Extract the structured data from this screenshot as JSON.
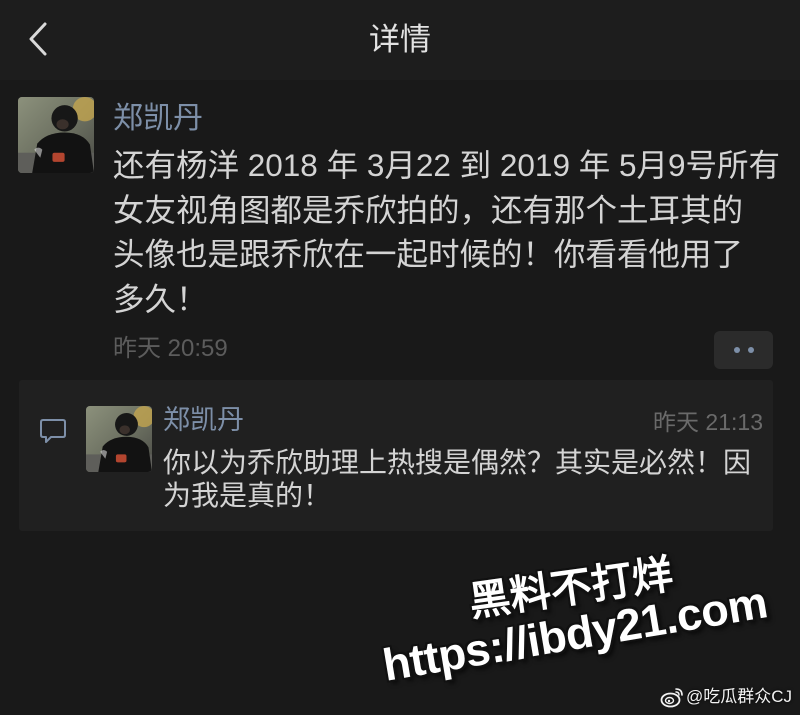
{
  "colors": {
    "background": "#191919",
    "topbar": "#1d1d1d",
    "panel": "#202020",
    "accent": "#7d8fa8",
    "text": "#d4d4d4",
    "muted": "#5c5c5c",
    "muted2": "#6a6a6a",
    "title": "#e3e3e3",
    "button": "#2b2b2b"
  },
  "icons": {
    "back": "chevron-left-icon",
    "more": "more-dots-icon",
    "comment": "comment-bubble-icon",
    "weibo": "weibo-logo-icon"
  },
  "header": {
    "title": "详情"
  },
  "post": {
    "author": "郑凯丹",
    "text_lines": [
      "还有杨洋 2018 年 3月22 到 2019 年 5月9号所有",
      "女友视角图都是乔欣拍的，还有那个土耳其的",
      "头像也是跟乔欣在一起时候的！你看看他用了",
      "多久！"
    ],
    "timestamp": "昨天 20:59"
  },
  "comments": [
    {
      "author": "郑凯丹",
      "time": "昨天 21:13",
      "text_lines": [
        "你以为乔欣助理上热搜是偶然？其实是必然！因",
        "为我是真的！"
      ]
    }
  ],
  "watermarks": {
    "slogan": "黑料不打烊",
    "url": "https://ibdy21.com",
    "weibo_handle": "@吃瓜群众CJ"
  }
}
